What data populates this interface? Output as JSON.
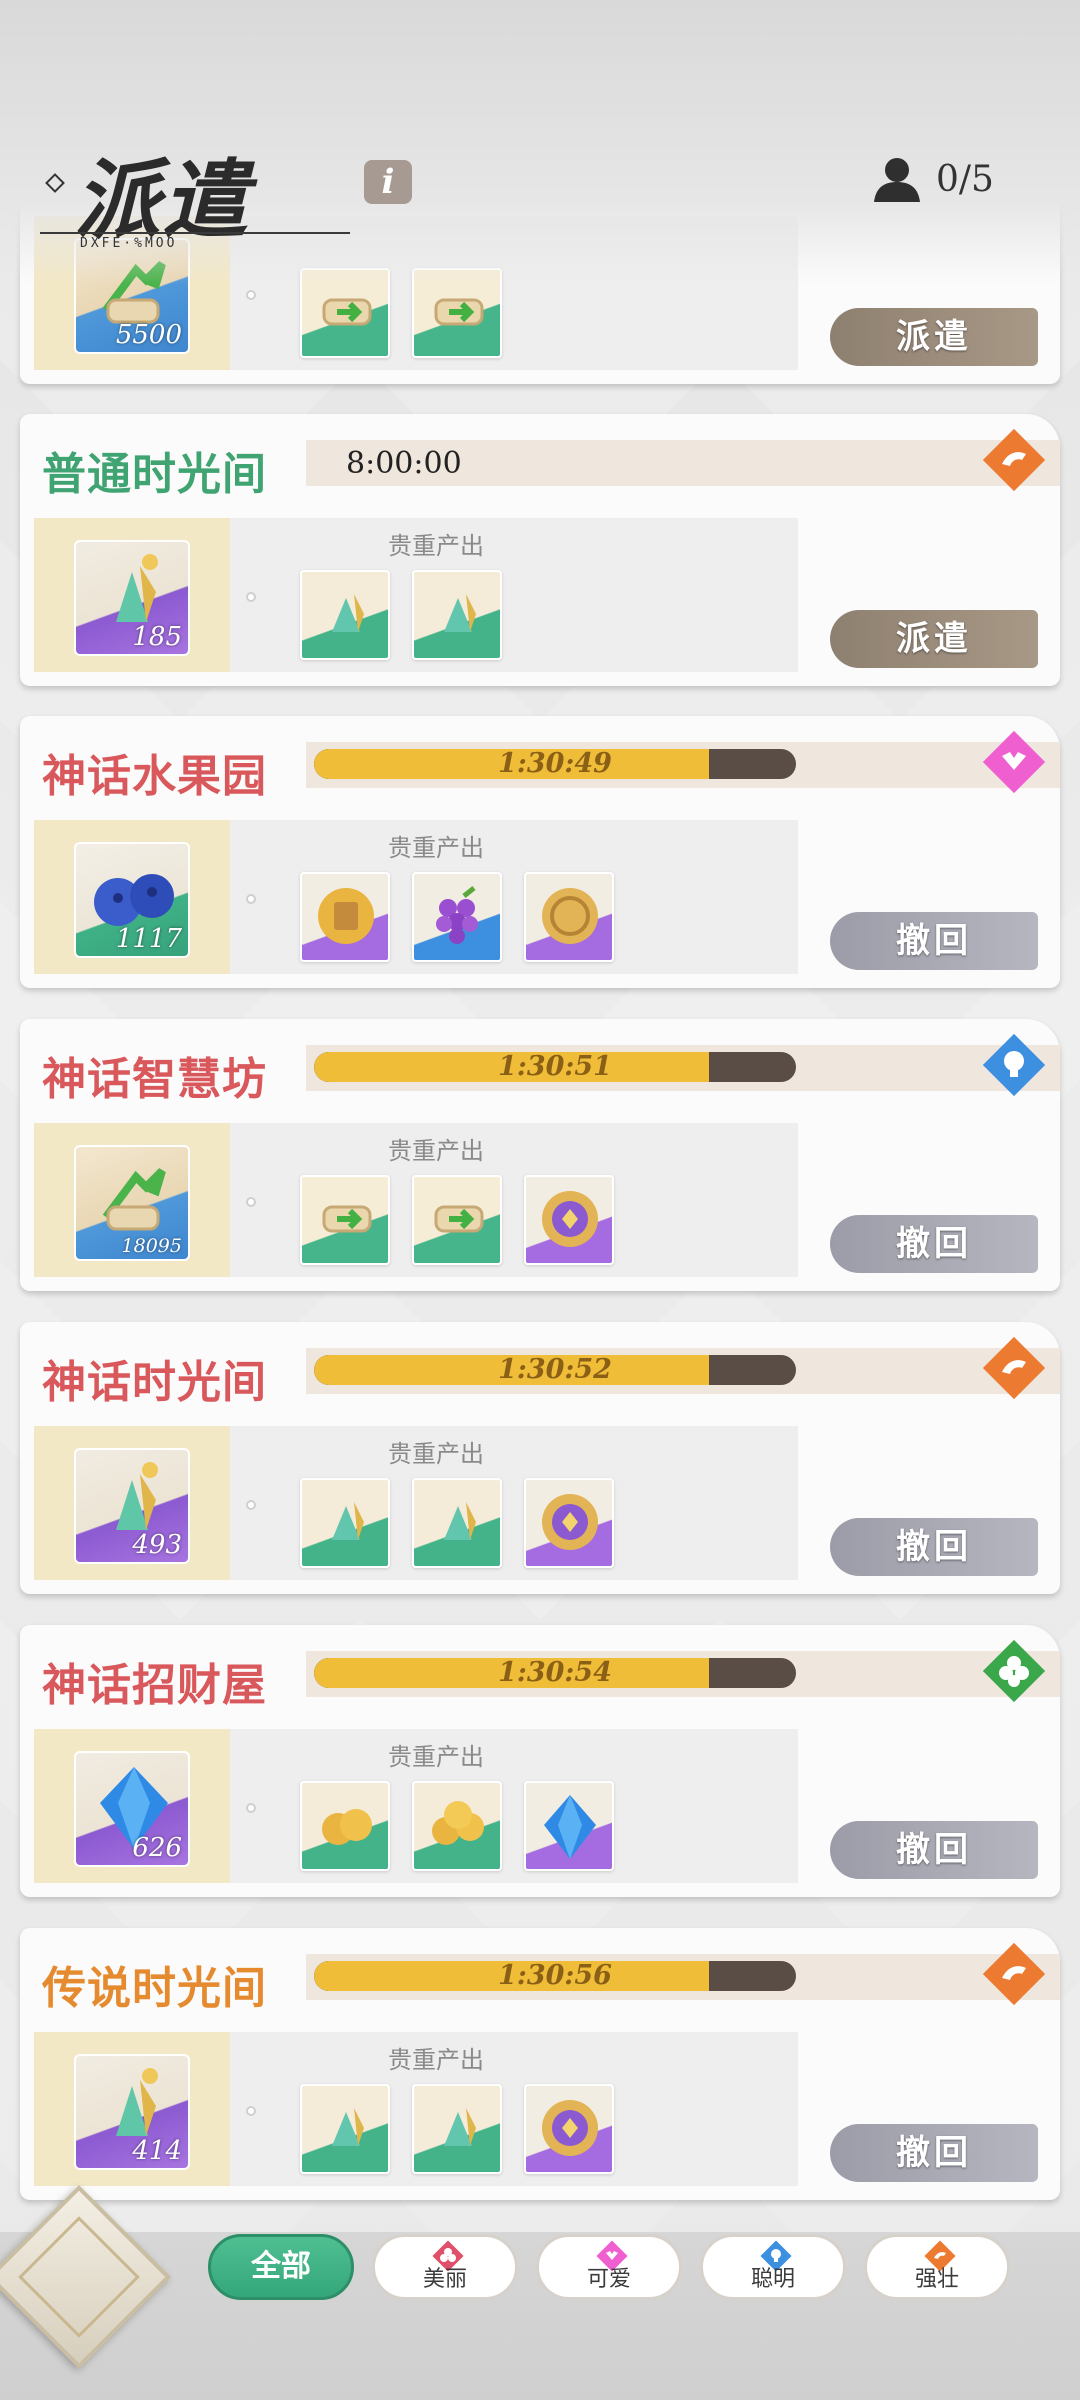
{
  "header": {
    "title": "派遣",
    "subtitle": "DXFE·%MOO",
    "info_label": "i",
    "slots": "0/5"
  },
  "cards": [
    {
      "name": "",
      "main_item_count": "5500",
      "precious_label": "",
      "action_label": "派遣"
    },
    {
      "name": "普通时光间",
      "timer": "8:00:00",
      "type_icon": "strength-icon",
      "main_item_count": "185",
      "precious_label": "贵重产出",
      "action_label": "派遣"
    },
    {
      "name": "神话水果园",
      "timer": "1:30:49",
      "progress": 0.82,
      "type_icon": "cute-icon",
      "main_item_count": "1117",
      "precious_label": "贵重产出",
      "action_label": "撤回"
    },
    {
      "name": "神话智慧坊",
      "timer": "1:30:51",
      "progress": 0.82,
      "type_icon": "smart-icon",
      "main_item_count": "18095",
      "precious_label": "贵重产出",
      "action_label": "撤回"
    },
    {
      "name": "神话时光间",
      "timer": "1:30:52",
      "progress": 0.82,
      "type_icon": "strength-icon",
      "main_item_count": "493",
      "precious_label": "贵重产出",
      "action_label": "撤回"
    },
    {
      "name": "神话招财屋",
      "timer": "1:30:54",
      "progress": 0.82,
      "type_icon": "beauty-icon",
      "main_item_count": "626",
      "precious_label": "贵重产出",
      "action_label": "撤回"
    },
    {
      "name": "传说时光间",
      "timer": "1:30:56",
      "progress": 0.82,
      "type_icon": "strength-icon",
      "main_item_count": "414",
      "precious_label": "贵重产出",
      "action_label": "撤回"
    }
  ],
  "filters": {
    "all": "全部",
    "beauty": "美丽",
    "cute": "可爱",
    "smart": "聪明",
    "strong": "强壮"
  },
  "colors": {
    "green_name": "#3fa372",
    "myth_name": "#d9585c",
    "legend_name": "#e58a2e",
    "progress_fill": "#f0bd38",
    "progress_track": "#5a4d46",
    "strength": "#ec7a30",
    "cute": "#ef5fd0",
    "smart": "#3d8fe0",
    "beauty": "#3aa84a"
  }
}
